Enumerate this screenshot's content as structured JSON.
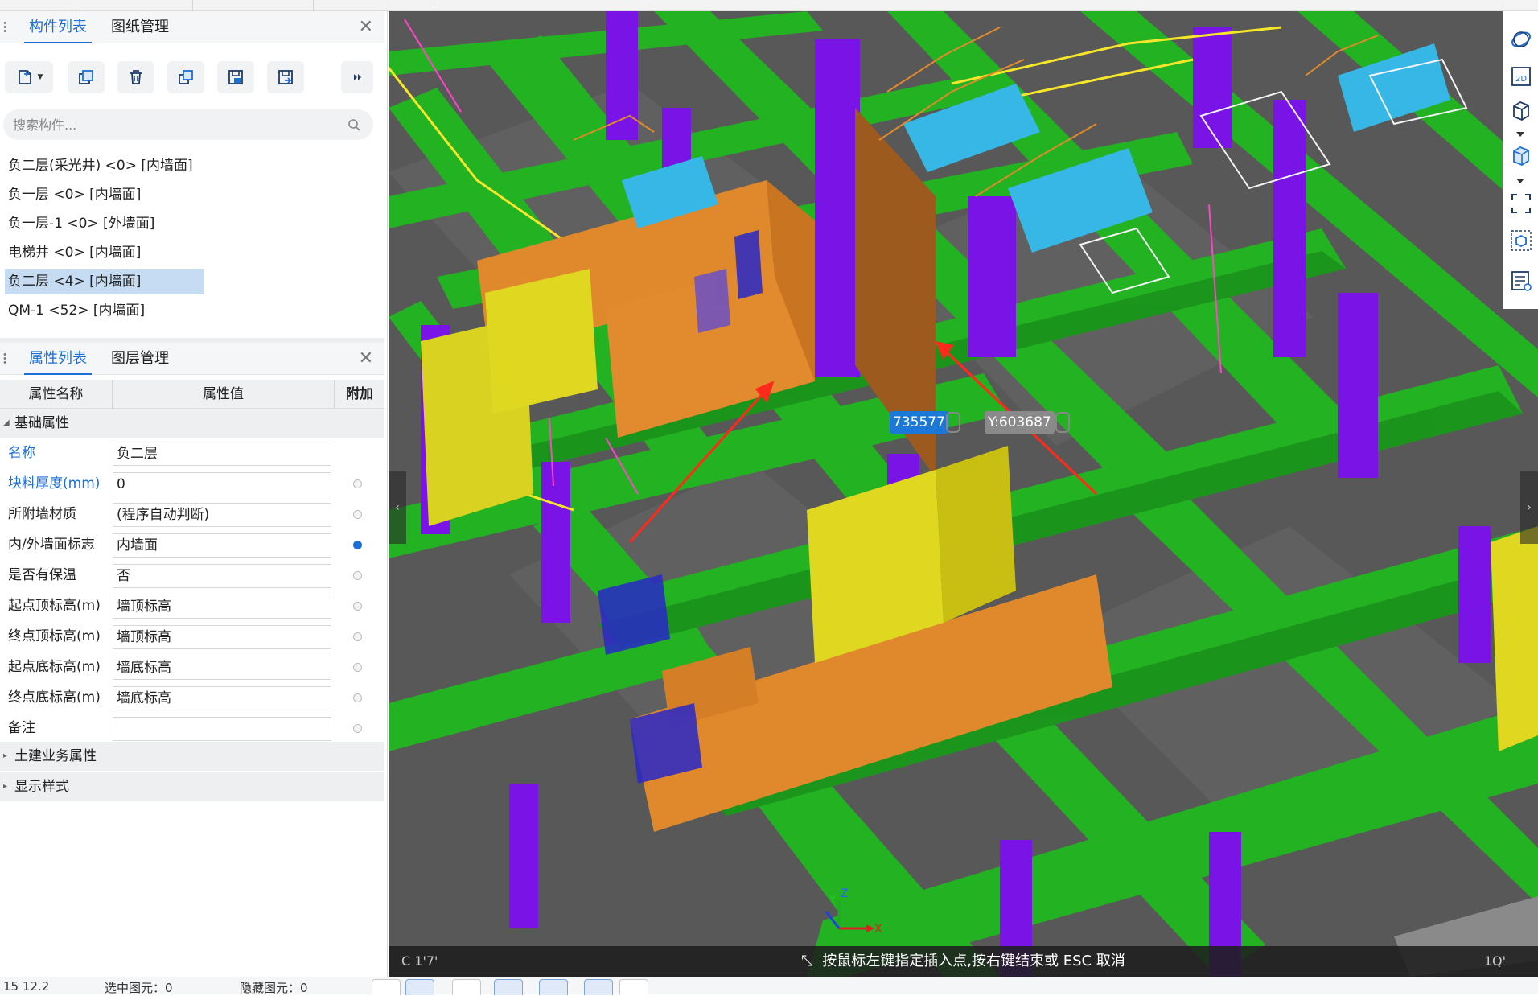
{
  "component_panel": {
    "tabs": [
      {
        "label": "构件列表",
        "active": true
      },
      {
        "label": "图纸管理",
        "active": false
      }
    ],
    "toolbar": {
      "buttons": [
        "new-icon",
        "copy-icon",
        "delete-icon",
        "layer-copy-icon",
        "floor-copy-icon",
        "floor-paste-icon",
        "more-icon"
      ]
    },
    "search_placeholder": "搜索构件...",
    "items": [
      {
        "label": "负二层(采光井) <0> [内墙面]",
        "selected": false
      },
      {
        "label": "负一层 <0> [内墙面]",
        "selected": false
      },
      {
        "label": "负一层-1 <0> [外墙面]",
        "selected": false
      },
      {
        "label": "电梯井 <0> [内墙面]",
        "selected": false
      },
      {
        "label": "负二层 <4> [内墙面]",
        "selected": true
      },
      {
        "label": "QM-1 <52> [内墙面]",
        "selected": false
      }
    ]
  },
  "property_panel": {
    "tabs": [
      {
        "label": "属性列表",
        "active": true
      },
      {
        "label": "图层管理",
        "active": false
      }
    ],
    "columns": {
      "name": "属性名称",
      "value": "属性值",
      "extra": "附加"
    },
    "group_basic": "基础属性",
    "rows": [
      {
        "name": "名称",
        "value": "负二层",
        "blue": true,
        "radio": null
      },
      {
        "name": "块料厚度(mm)",
        "value": "0",
        "blue": true,
        "radio": false
      },
      {
        "name": "所附墙材质",
        "value": "(程序自动判断)",
        "blue": false,
        "radio": false
      },
      {
        "name": "内/外墙面标志",
        "value": "内墙面",
        "blue": false,
        "radio": true
      },
      {
        "name": "是否有保温",
        "value": "否",
        "blue": false,
        "radio": false
      },
      {
        "name": "起点顶标高(m)",
        "value": "墙顶标高",
        "blue": false,
        "radio": false
      },
      {
        "name": "终点顶标高(m)",
        "value": "墙顶标高",
        "blue": false,
        "radio": false
      },
      {
        "name": "起点底标高(m)",
        "value": "墙底标高",
        "blue": false,
        "radio": false
      },
      {
        "name": "终点底标高(m)",
        "value": "墙底标高",
        "blue": false,
        "radio": false
      },
      {
        "name": "备注",
        "value": "",
        "blue": false,
        "radio": false
      }
    ],
    "groups_collapsed": [
      "土建业务属性",
      "显示样式"
    ]
  },
  "viewport": {
    "coord_x": "735577",
    "coord_y": "Y:603687",
    "hint": "按鼠标左键指定插入点,按右键结束或 ESC 取消",
    "axis_labels": {
      "x": "X",
      "y": "Y",
      "z": "Z"
    },
    "colors": {
      "floor": "#5a5a5a",
      "beam": "#22b222",
      "column": "#7a13e6",
      "wall_orange": "#e0882c",
      "wall_yellow": "#e0d820",
      "stair": "#36b7e6",
      "arrow": "#ff2a1a"
    },
    "right_tools": [
      "orbit-icon",
      "2d-view-icon",
      "3d-box-icon",
      "3d-solid-icon",
      "fit-view-icon",
      "view-cube-icon",
      "display-settings-icon"
    ]
  },
  "bottom_bar": {
    "left_text": "15  12.2",
    "selected_label": "选中图元：0",
    "hidden_label": "隐藏图元：0"
  }
}
